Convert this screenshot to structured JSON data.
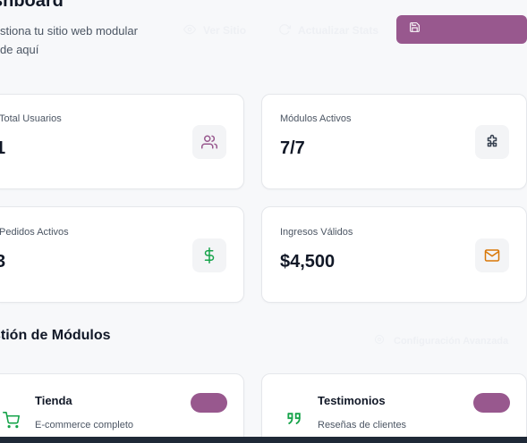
{
  "header": {
    "title": "shboard",
    "subtitle": "stiona tu sitio web modular de aquí",
    "view_site_label": "Ver Sitio",
    "update_stats_label": "Actualizar Stats",
    "save_label": ""
  },
  "stats": [
    {
      "label": "Total Usuarios",
      "value": "1",
      "icon": "users-icon",
      "icon_color": "#98588e"
    },
    {
      "label": "Módulos Activos",
      "value": "7/7",
      "icon": "puzzle-icon",
      "icon_color": "#374151"
    },
    {
      "label": "Pedidos Activos",
      "value": "3",
      "icon": "dollar-icon",
      "icon_color": "#16a34a"
    },
    {
      "label": "Ingresos Válidos",
      "value": "$4,500",
      "icon": "mail-icon",
      "icon_color": "#d97706"
    }
  ],
  "modules_section": {
    "title": "stión de Módulos",
    "config_label": "Configuración Avanzada"
  },
  "modules": [
    {
      "name": "Tienda",
      "description": "E-commerce completo",
      "icon": "cart-icon",
      "enabled": true
    },
    {
      "name": "Testimonios",
      "description": "Reseñas de clientes",
      "icon": "quote-icon",
      "enabled": true
    }
  ],
  "colors": {
    "accent": "#98588e",
    "background": "#f7f8fa"
  }
}
